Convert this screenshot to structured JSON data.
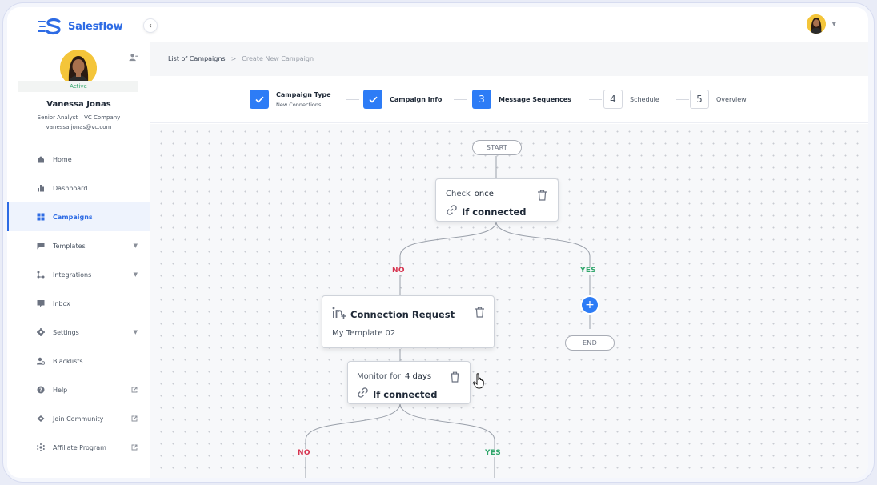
{
  "app": {
    "name": "Salesflow",
    "brand_color": "#2d6be4"
  },
  "user": {
    "status": "Active",
    "name": "Vanessa Jonas",
    "role": "Senior Analyst – VC Company",
    "email": "vanessa.jonas@vc.com"
  },
  "nav": {
    "items": [
      {
        "label": "Home",
        "icon": "home-icon"
      },
      {
        "label": "Dashboard",
        "icon": "bar-chart-icon"
      },
      {
        "label": "Campaigns",
        "icon": "grid-icon",
        "active": true
      },
      {
        "label": "Templates",
        "icon": "chat-icon",
        "trailing": "caret-down-icon"
      },
      {
        "label": "Integrations",
        "icon": "integrations-icon",
        "trailing": "caret-down-icon"
      },
      {
        "label": "Inbox",
        "icon": "inbox-icon"
      },
      {
        "label": "Settings",
        "icon": "gear-icon",
        "trailing": "caret-down-icon"
      },
      {
        "label": "Blacklists",
        "icon": "blacklist-icon"
      },
      {
        "label": "Help",
        "icon": "help-icon",
        "trailing": "external-link-icon"
      },
      {
        "label": "Join Community",
        "icon": "community-icon",
        "trailing": "external-link-icon"
      },
      {
        "label": "Affiliate Program",
        "icon": "affiliate-icon",
        "trailing": "external-link-icon"
      }
    ]
  },
  "breadcrumb": {
    "items": [
      "List of Campaigns",
      "Create New Campaign"
    ],
    "separator": ">"
  },
  "steps": [
    {
      "label": "Campaign Type",
      "sub": "New Connections",
      "state": "done"
    },
    {
      "label": "Campaign Info",
      "state": "done"
    },
    {
      "number": "3",
      "label": "Message Sequences",
      "state": "current"
    },
    {
      "number": "4",
      "label": "Schedule",
      "state": "pending"
    },
    {
      "number": "5",
      "label": "Overview",
      "state": "pending"
    }
  ],
  "flow": {
    "start": "START",
    "end": "END",
    "check_node": {
      "label": "Check",
      "value": "once",
      "condition": "If connected"
    },
    "branch_no": "NO",
    "branch_yes": "YES",
    "connection_node": {
      "title": "Connection Request",
      "template": "My Template 02"
    },
    "monitor_node": {
      "label": "Monitor for",
      "value": "4 days",
      "condition": "If connected"
    },
    "branch_no_2": "NO",
    "branch_yes_2": "YES",
    "add_symbol": "+"
  },
  "colors": {
    "accent": "#2d7cf6",
    "no": "#d6334f",
    "yes": "#2fa56a"
  }
}
